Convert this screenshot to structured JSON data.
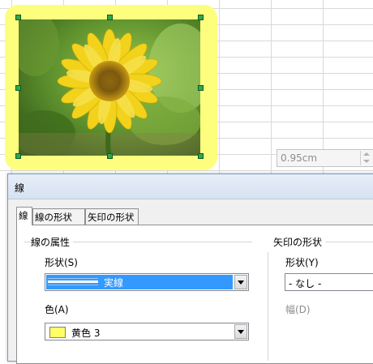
{
  "dialog": {
    "title": "線",
    "tabs": [
      {
        "label": "線",
        "active": true
      },
      {
        "label": "線の形状",
        "active": false
      },
      {
        "label": "矢印の形状",
        "active": false
      }
    ],
    "line_properties": {
      "group_title": "線の属性",
      "style_label": "形状(S)",
      "style_value": "実線",
      "color_label": "色(A)",
      "color_value": "黄色 3",
      "color_swatch": "#ffff66"
    },
    "arrow_styles": {
      "group_title": "矢印の形状",
      "style_label": "形状(Y)",
      "style_value": "- なし -",
      "width_label": "幅(D)",
      "width_value": "0.95cm"
    }
  },
  "image": {
    "subject": "sunflower photo",
    "border_color": "#fefe7e"
  },
  "colors": {
    "selection": "#3399ff",
    "handle": "#2fa84f",
    "dialog_bg": "#f0f0f0"
  }
}
